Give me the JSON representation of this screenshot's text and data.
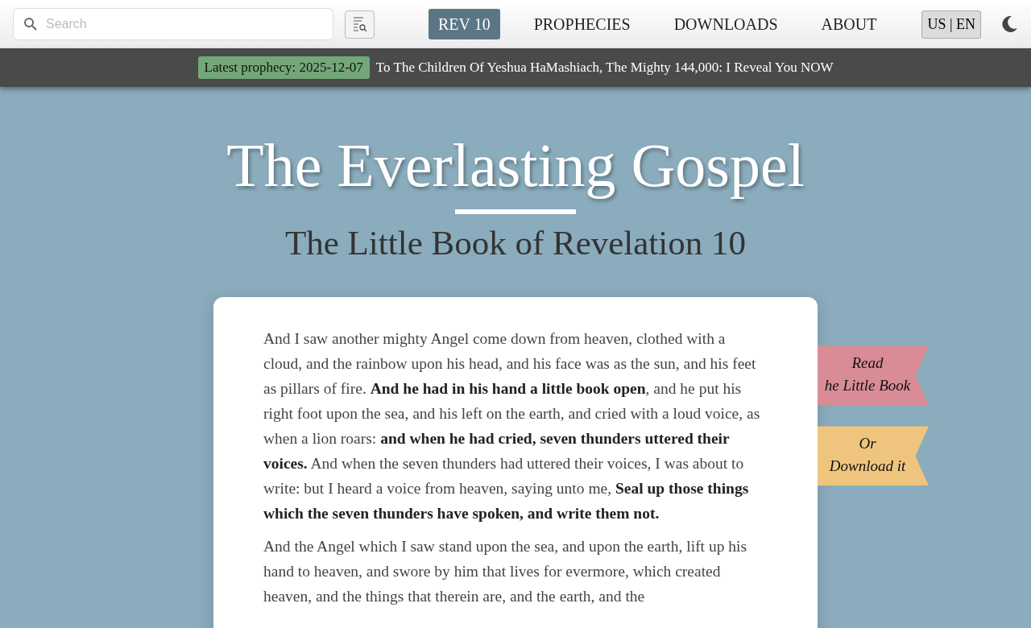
{
  "search": {
    "placeholder": "Search"
  },
  "nav": [
    {
      "label": "REV 10",
      "selected": true
    },
    {
      "label": "PROPHECIES",
      "selected": false
    },
    {
      "label": "DOWNLOADS",
      "selected": false
    },
    {
      "label": "ABOUT",
      "selected": false
    }
  ],
  "language": "US | EN",
  "ticker": {
    "badge": "Latest prophecy: 2025-12-07",
    "headline": "To The Children Of Yeshua HaMashiach, The Mighty 144,000: I Reveal You NOW"
  },
  "hero": {
    "title": "The Everlasting Gospel",
    "subtitle": "The Little Book of Revelation 10"
  },
  "ribbons": [
    {
      "text": "Read\nhe Little Book",
      "color": "#d98c95"
    },
    {
      "text": "Or\nDownload it",
      "color": "#efc57e"
    }
  ],
  "paragraphs": [
    "And I saw another mighty Angel come down from heaven, clothed with a cloud, and the rainbow upon his head, and his face was as the sun, and his feet as pillars of fire. **And he had in his hand a little book open**, and he put his right foot upon the sea, and his left on the earth, and cried with a loud voice, as when a lion roars: **and when he had cried, seven thunders uttered their voices.** And when the seven thunders had uttered their voices, I was about to write: but I heard a voice from heaven, saying unto me, **Seal up those things which the seven thunders have spoken, and write them not.**",
    "And the Angel which I saw stand upon the sea, and upon the earth, lift up his hand to heaven, and swore by him that lives for evermore, which created heaven, and the things that therein are, and the earth, and the"
  ]
}
